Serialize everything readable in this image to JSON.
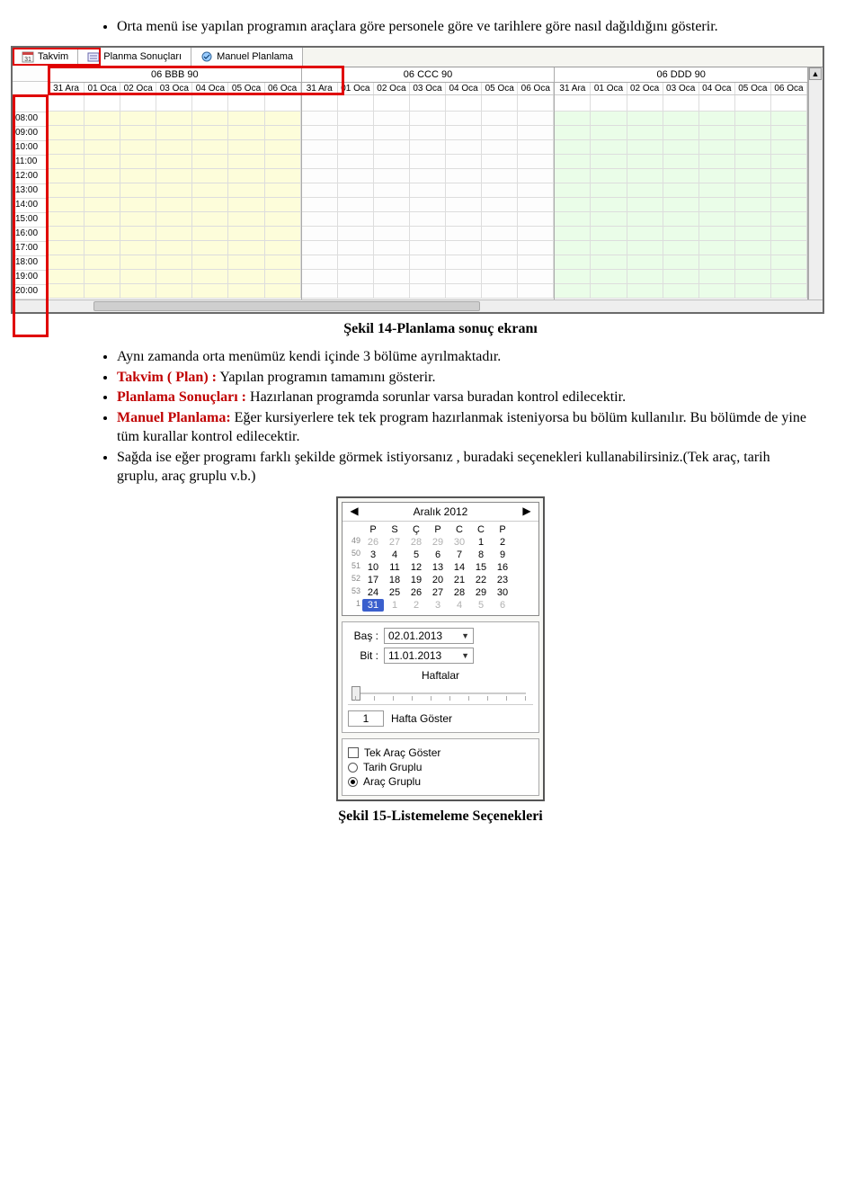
{
  "intro_bullet": "Orta menü ise yapılan programın araçlara göre personele göre ve tarihlere göre nasıl dağıldığını gösterir.",
  "screenshot1": {
    "tabs": [
      {
        "label": "Takvim",
        "icon": "calendar-31-icon",
        "active": true
      },
      {
        "label": "Planma Sonuçları",
        "icon": "results-icon",
        "active": false
      },
      {
        "label": "Manuel Planlama",
        "icon": "manual-icon",
        "active": false
      }
    ],
    "cars": [
      "06 BBB 90",
      "06 CCC 90",
      "06 DDD 90"
    ],
    "dates": [
      "31 Ara",
      "01 Oca",
      "02 Oca",
      "03 Oca",
      "04 Oca",
      "05 Oca",
      "06 Oca"
    ],
    "times": [
      "08:00",
      "09:00",
      "10:00",
      "11:00",
      "12:00",
      "13:00",
      "14:00",
      "15:00",
      "16:00",
      "17:00",
      "18:00",
      "19:00",
      "20:00"
    ]
  },
  "caption1": "Şekil 14-Planlama sonuç ekranı",
  "bullets2": {
    "b1": "Aynı zamanda orta menümüz kendi içinde 3 bölüme ayrılmaktadır.",
    "b2a": "Takvim ( Plan) :",
    "b2b": " Yapılan programın tamamını gösterir.",
    "b3a": "Planlama Sonuçları :",
    "b3b": " Hazırlanan programda sorunlar varsa buradan kontrol edilecektir.",
    "b4a": "Manuel Planlama:",
    "b4b": " Eğer kursiyerlere tek tek program hazırlanmak isteniyorsa bu bölüm kullanılır. Bu bölümde de yine tüm kurallar kontrol edilecektir.",
    "b5": "Sağda ise eğer programı farklı şekilde görmek istiyorsanız , buradaki seçenekleri kullanabilirsiniz.(Tek araç, tarih gruplu, araç gruplu v.b.)"
  },
  "options": {
    "month_title": "Aralık 2012",
    "day_headers": [
      "P",
      "S",
      "Ç",
      "P",
      "C",
      "C",
      "P"
    ],
    "weeks": [
      {
        "wk": "49",
        "days": [
          "26",
          "27",
          "28",
          "29",
          "30",
          "1",
          "2"
        ],
        "dim": [
          0,
          1,
          2,
          3,
          4
        ]
      },
      {
        "wk": "50",
        "days": [
          "3",
          "4",
          "5",
          "6",
          "7",
          "8",
          "9"
        ],
        "dim": []
      },
      {
        "wk": "51",
        "days": [
          "10",
          "11",
          "12",
          "13",
          "14",
          "15",
          "16"
        ],
        "dim": []
      },
      {
        "wk": "52",
        "days": [
          "17",
          "18",
          "19",
          "20",
          "21",
          "22",
          "23"
        ],
        "dim": []
      },
      {
        "wk": "53",
        "days": [
          "24",
          "25",
          "26",
          "27",
          "28",
          "29",
          "30"
        ],
        "dim": []
      },
      {
        "wk": "1",
        "days": [
          "31",
          "1",
          "2",
          "3",
          "4",
          "5",
          "6"
        ],
        "dim": [
          1,
          2,
          3,
          4,
          5,
          6
        ],
        "sel": 0
      }
    ],
    "bas_label": "Baş :",
    "bit_label": "Bit :",
    "bas_value": "02.01.2013",
    "bit_value": "11.01.2013",
    "haftalar_label": "Haftalar",
    "hafta_num": "1",
    "hafta_goster_label": "Hafta Göster",
    "tek_arac_label": "Tek Araç Göster",
    "tarih_gruplu_label": "Tarih Gruplu",
    "arac_gruplu_label": "Araç Gruplu"
  },
  "caption2": "Şekil 15-Listemeleme Seçenekleri"
}
